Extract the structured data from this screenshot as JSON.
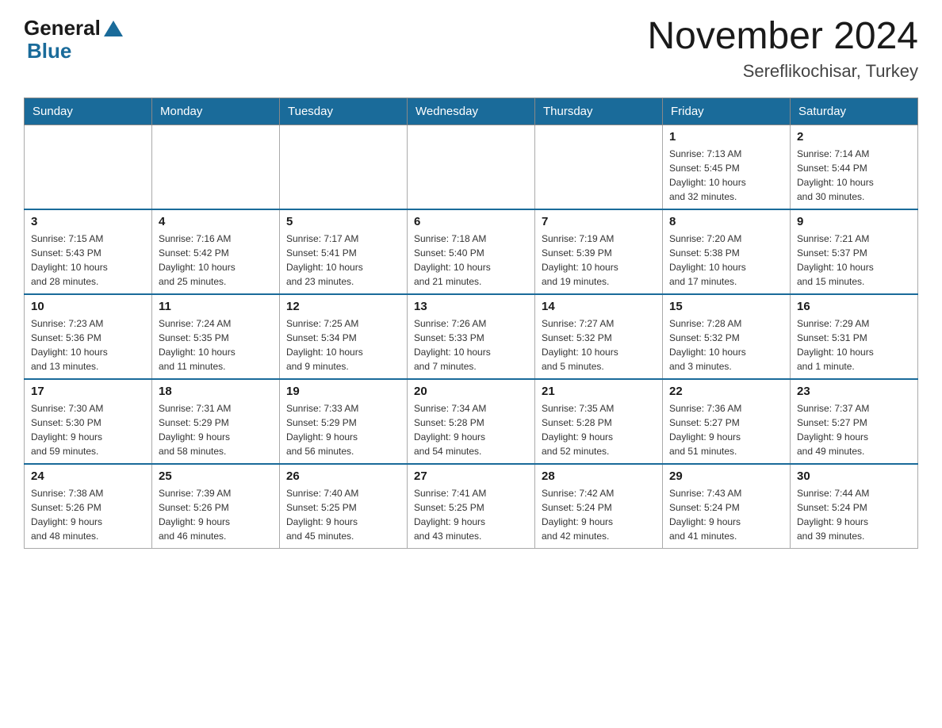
{
  "header": {
    "logo_general": "General",
    "logo_blue": "Blue",
    "month": "November 2024",
    "location": "Sereflikochisar, Turkey"
  },
  "days_of_week": [
    "Sunday",
    "Monday",
    "Tuesday",
    "Wednesday",
    "Thursday",
    "Friday",
    "Saturday"
  ],
  "weeks": [
    [
      {
        "day": "",
        "info": ""
      },
      {
        "day": "",
        "info": ""
      },
      {
        "day": "",
        "info": ""
      },
      {
        "day": "",
        "info": ""
      },
      {
        "day": "",
        "info": ""
      },
      {
        "day": "1",
        "info": "Sunrise: 7:13 AM\nSunset: 5:45 PM\nDaylight: 10 hours\nand 32 minutes."
      },
      {
        "day": "2",
        "info": "Sunrise: 7:14 AM\nSunset: 5:44 PM\nDaylight: 10 hours\nand 30 minutes."
      }
    ],
    [
      {
        "day": "3",
        "info": "Sunrise: 7:15 AM\nSunset: 5:43 PM\nDaylight: 10 hours\nand 28 minutes."
      },
      {
        "day": "4",
        "info": "Sunrise: 7:16 AM\nSunset: 5:42 PM\nDaylight: 10 hours\nand 25 minutes."
      },
      {
        "day": "5",
        "info": "Sunrise: 7:17 AM\nSunset: 5:41 PM\nDaylight: 10 hours\nand 23 minutes."
      },
      {
        "day": "6",
        "info": "Sunrise: 7:18 AM\nSunset: 5:40 PM\nDaylight: 10 hours\nand 21 minutes."
      },
      {
        "day": "7",
        "info": "Sunrise: 7:19 AM\nSunset: 5:39 PM\nDaylight: 10 hours\nand 19 minutes."
      },
      {
        "day": "8",
        "info": "Sunrise: 7:20 AM\nSunset: 5:38 PM\nDaylight: 10 hours\nand 17 minutes."
      },
      {
        "day": "9",
        "info": "Sunrise: 7:21 AM\nSunset: 5:37 PM\nDaylight: 10 hours\nand 15 minutes."
      }
    ],
    [
      {
        "day": "10",
        "info": "Sunrise: 7:23 AM\nSunset: 5:36 PM\nDaylight: 10 hours\nand 13 minutes."
      },
      {
        "day": "11",
        "info": "Sunrise: 7:24 AM\nSunset: 5:35 PM\nDaylight: 10 hours\nand 11 minutes."
      },
      {
        "day": "12",
        "info": "Sunrise: 7:25 AM\nSunset: 5:34 PM\nDaylight: 10 hours\nand 9 minutes."
      },
      {
        "day": "13",
        "info": "Sunrise: 7:26 AM\nSunset: 5:33 PM\nDaylight: 10 hours\nand 7 minutes."
      },
      {
        "day": "14",
        "info": "Sunrise: 7:27 AM\nSunset: 5:32 PM\nDaylight: 10 hours\nand 5 minutes."
      },
      {
        "day": "15",
        "info": "Sunrise: 7:28 AM\nSunset: 5:32 PM\nDaylight: 10 hours\nand 3 minutes."
      },
      {
        "day": "16",
        "info": "Sunrise: 7:29 AM\nSunset: 5:31 PM\nDaylight: 10 hours\nand 1 minute."
      }
    ],
    [
      {
        "day": "17",
        "info": "Sunrise: 7:30 AM\nSunset: 5:30 PM\nDaylight: 9 hours\nand 59 minutes."
      },
      {
        "day": "18",
        "info": "Sunrise: 7:31 AM\nSunset: 5:29 PM\nDaylight: 9 hours\nand 58 minutes."
      },
      {
        "day": "19",
        "info": "Sunrise: 7:33 AM\nSunset: 5:29 PM\nDaylight: 9 hours\nand 56 minutes."
      },
      {
        "day": "20",
        "info": "Sunrise: 7:34 AM\nSunset: 5:28 PM\nDaylight: 9 hours\nand 54 minutes."
      },
      {
        "day": "21",
        "info": "Sunrise: 7:35 AM\nSunset: 5:28 PM\nDaylight: 9 hours\nand 52 minutes."
      },
      {
        "day": "22",
        "info": "Sunrise: 7:36 AM\nSunset: 5:27 PM\nDaylight: 9 hours\nand 51 minutes."
      },
      {
        "day": "23",
        "info": "Sunrise: 7:37 AM\nSunset: 5:27 PM\nDaylight: 9 hours\nand 49 minutes."
      }
    ],
    [
      {
        "day": "24",
        "info": "Sunrise: 7:38 AM\nSunset: 5:26 PM\nDaylight: 9 hours\nand 48 minutes."
      },
      {
        "day": "25",
        "info": "Sunrise: 7:39 AM\nSunset: 5:26 PM\nDaylight: 9 hours\nand 46 minutes."
      },
      {
        "day": "26",
        "info": "Sunrise: 7:40 AM\nSunset: 5:25 PM\nDaylight: 9 hours\nand 45 minutes."
      },
      {
        "day": "27",
        "info": "Sunrise: 7:41 AM\nSunset: 5:25 PM\nDaylight: 9 hours\nand 43 minutes."
      },
      {
        "day": "28",
        "info": "Sunrise: 7:42 AM\nSunset: 5:24 PM\nDaylight: 9 hours\nand 42 minutes."
      },
      {
        "day": "29",
        "info": "Sunrise: 7:43 AM\nSunset: 5:24 PM\nDaylight: 9 hours\nand 41 minutes."
      },
      {
        "day": "30",
        "info": "Sunrise: 7:44 AM\nSunset: 5:24 PM\nDaylight: 9 hours\nand 39 minutes."
      }
    ]
  ]
}
